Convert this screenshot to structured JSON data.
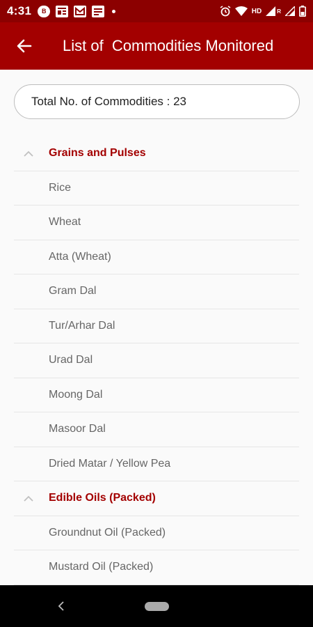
{
  "status_bar": {
    "time": "4:31",
    "badge_b": "B",
    "network": "HD",
    "signal_r": "R"
  },
  "app_bar": {
    "title": "List of  Commodities Monitored"
  },
  "summary": {
    "total_text": "Total No. of Commodities : 23"
  },
  "groups": [
    {
      "title": "Grains and Pulses",
      "items": [
        "Rice",
        "Wheat",
        "Atta (Wheat)",
        "Gram Dal",
        "Tur/Arhar Dal",
        "Urad Dal",
        "Moong Dal",
        "Masoor Dal",
        "Dried Matar / Yellow Pea"
      ]
    },
    {
      "title": "Edible Oils (Packed)",
      "items": [
        "Groundnut Oil (Packed)",
        "Mustard Oil (Packed)"
      ]
    }
  ],
  "colors": {
    "status_bar": "#8c0000",
    "app_bar": "#a30000",
    "group_title": "#a30000"
  }
}
